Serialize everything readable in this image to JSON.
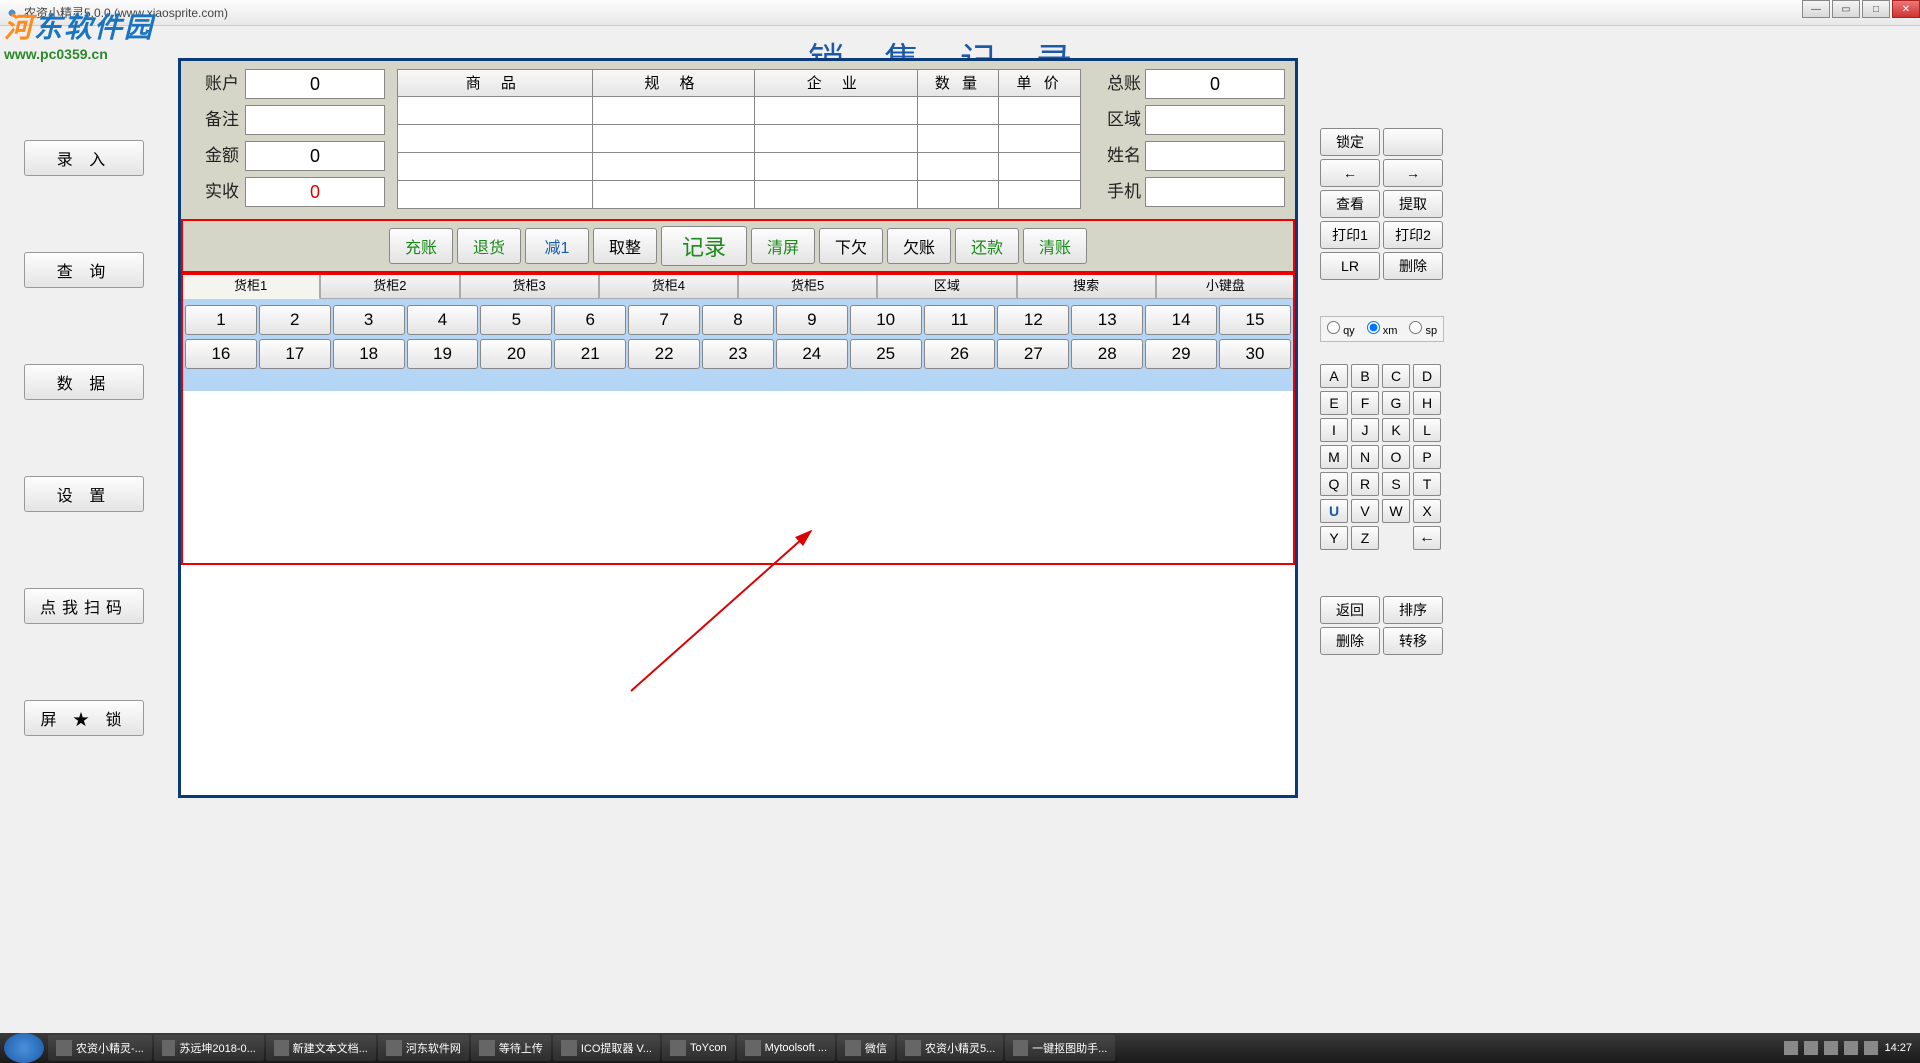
{
  "window": {
    "title": "农资小精灵5.0.0    (www.xiaosprite.com)"
  },
  "watermark": {
    "cn": "河东软件园",
    "url": "www.pc0359.cn"
  },
  "page_title": "销售记录",
  "left_nav": [
    "录  入",
    "查  询",
    "数  据",
    "设  置",
    "点我扫码",
    "屏 ★ 锁"
  ],
  "form_left": {
    "labels": [
      "账户",
      "备注",
      "金额",
      "实收"
    ],
    "values": [
      "0",
      "",
      "0",
      "0"
    ]
  },
  "grid_headers": [
    "商  品",
    "规  格",
    "企  业",
    "数  量",
    "单  价"
  ],
  "form_right": {
    "labels": [
      "总账",
      "区域",
      "姓名",
      "手机"
    ],
    "values": [
      "0",
      "",
      "",
      ""
    ]
  },
  "actions": {
    "a1": "充账",
    "a2": "退货",
    "a3": "减1",
    "a4": "取整",
    "a5": "记录",
    "a6": "清屏",
    "a7": "下欠",
    "a8": "欠账",
    "a9": "还款",
    "a10": "清账"
  },
  "tabs": [
    "货柜1",
    "货柜2",
    "货柜3",
    "货柜4",
    "货柜5",
    "区域",
    "搜索",
    "小键盘"
  ],
  "numbers_row1": [
    "1",
    "2",
    "3",
    "4",
    "5",
    "6",
    "7",
    "8",
    "9",
    "10",
    "11",
    "12",
    "13",
    "14",
    "15"
  ],
  "numbers_row2": [
    "16",
    "17",
    "18",
    "19",
    "20",
    "21",
    "22",
    "23",
    "24",
    "25",
    "26",
    "27",
    "28",
    "29",
    "30"
  ],
  "right_buttons": {
    "r1": "锁定",
    "r2": "",
    "r3": "←",
    "r4": "→",
    "r5": "查看",
    "r6": "提取",
    "r7": "打印1",
    "r8": "打印2",
    "r9": "LR",
    "r10": "删除"
  },
  "radios": {
    "o1": "qy",
    "o2": "xm",
    "o3": "sp"
  },
  "letters": [
    "A",
    "B",
    "C",
    "D",
    "E",
    "F",
    "G",
    "H",
    "I",
    "J",
    "K",
    "L",
    "M",
    "N",
    "O",
    "P",
    "Q",
    "R",
    "S",
    "T",
    "U",
    "V",
    "W",
    "X",
    "Y",
    "Z",
    "",
    "←"
  ],
  "bottom_right": {
    "b1": "返回",
    "b2": "排序",
    "b3": "删除",
    "b4": "转移"
  },
  "taskbar": {
    "items": [
      "农资小精灵-...",
      "苏远坤2018-0...",
      "新建文本文档...",
      "河东软件网",
      "等待上传",
      "ICO提取器 V...",
      "ToYcon",
      "Mytoolsoft ...",
      "微信",
      "农资小精灵5...",
      "一键抠图助手..."
    ],
    "time": "14:27"
  }
}
